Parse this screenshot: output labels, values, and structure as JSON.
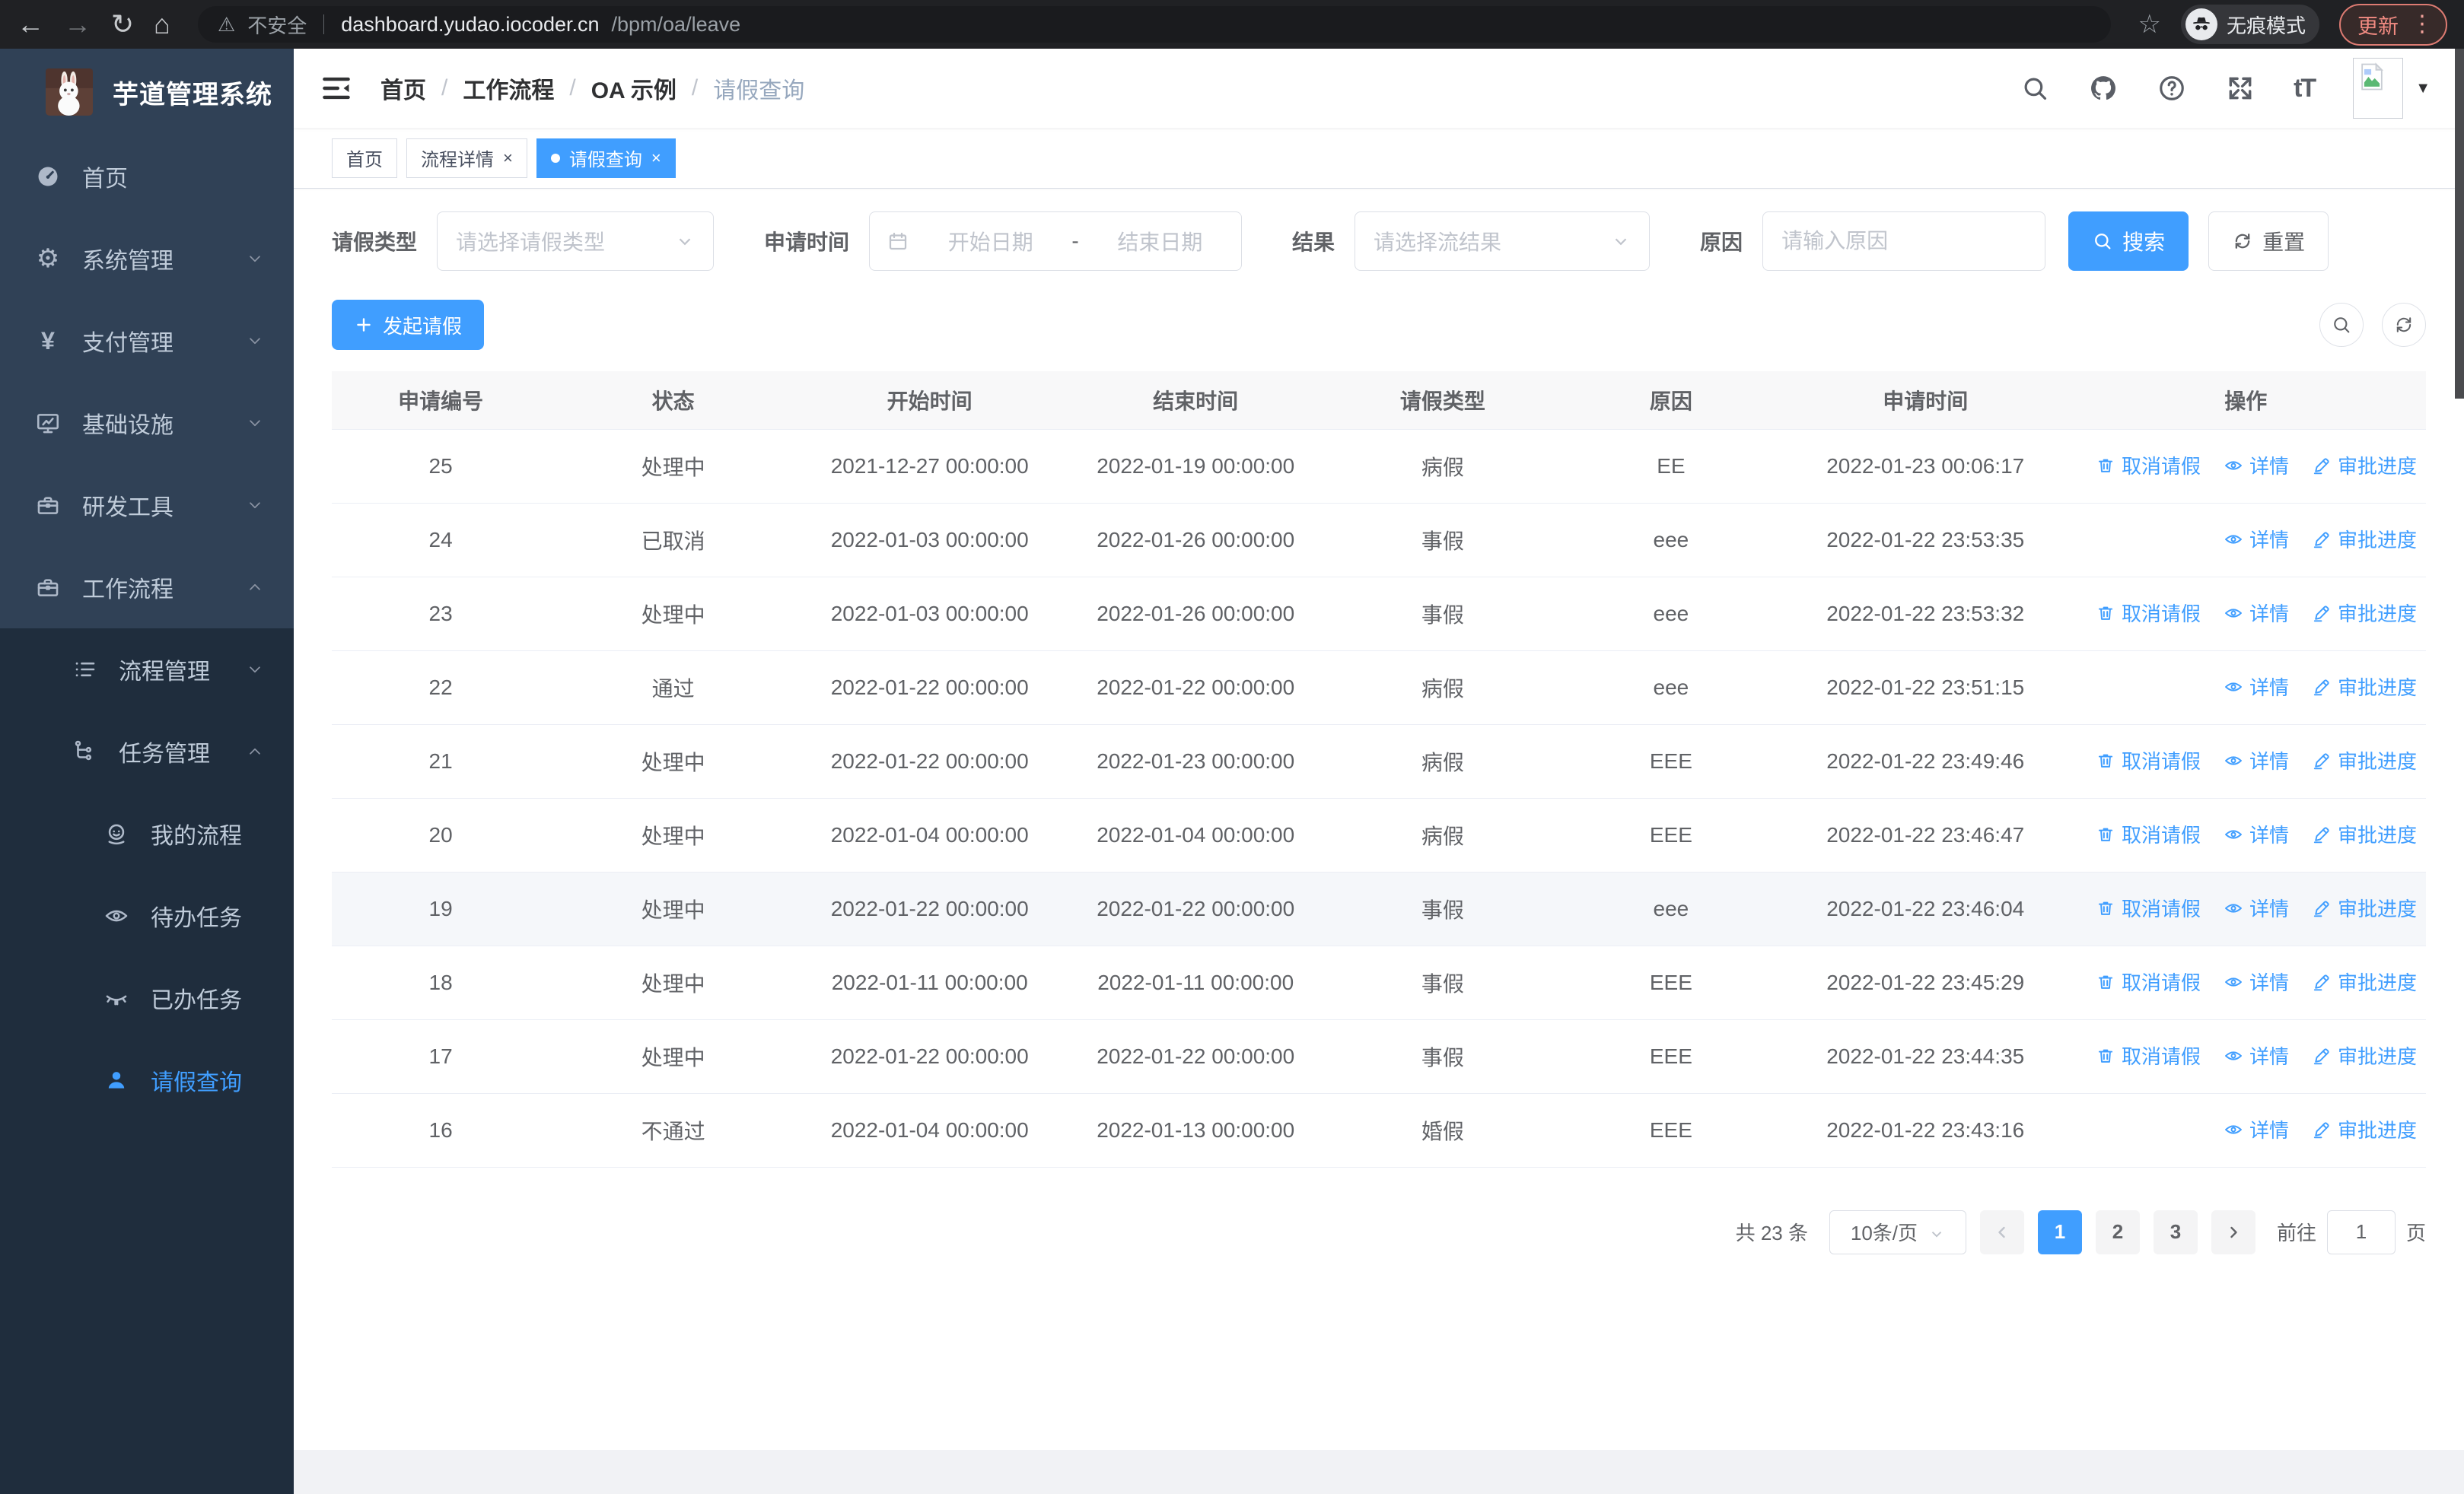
{
  "browser": {
    "security_label": "不安全",
    "url_domain": "dashboard.yudao.iocoder.cn",
    "url_path": "/bpm/oa/leave",
    "incognito_label": "无痕模式",
    "update_label": "更新"
  },
  "sidebar": {
    "title": "芋道管理系统",
    "items": [
      {
        "key": "home",
        "label": "首页",
        "icon": "dashboard",
        "level": 0
      },
      {
        "key": "system",
        "label": "系统管理",
        "icon": "gear",
        "level": 0,
        "arrow": "down"
      },
      {
        "key": "payment",
        "label": "支付管理",
        "icon": "yen",
        "level": 0,
        "arrow": "down"
      },
      {
        "key": "infra",
        "label": "基础设施",
        "icon": "monitor",
        "level": 0,
        "arrow": "down"
      },
      {
        "key": "dev-tools",
        "label": "研发工具",
        "icon": "briefcase",
        "level": 0,
        "arrow": "down"
      },
      {
        "key": "workflow",
        "label": "工作流程",
        "icon": "briefcase",
        "level": 0,
        "arrow": "up"
      },
      {
        "key": "process-mgmt",
        "label": "流程管理",
        "icon": "list",
        "level": 1,
        "sub": true,
        "arrow": "down"
      },
      {
        "key": "task-mgmt",
        "label": "任务管理",
        "icon": "tree",
        "level": 1,
        "sub": true,
        "arrow": "up"
      },
      {
        "key": "my-process",
        "label": "我的流程",
        "icon": "face",
        "level": 2,
        "sub": true
      },
      {
        "key": "todo-tasks",
        "label": "待办任务",
        "icon": "eye",
        "level": 2,
        "sub": true
      },
      {
        "key": "done-tasks",
        "label": "已办任务",
        "icon": "eyeclosed",
        "level": 2,
        "sub": true
      },
      {
        "key": "leave-query",
        "label": "请假查询",
        "icon": "user",
        "level": 2,
        "sub": true,
        "active": true
      }
    ]
  },
  "breadcrumb": [
    {
      "label": "首页"
    },
    {
      "label": "工作流程"
    },
    {
      "label": "OA 示例"
    },
    {
      "label": "请假查询",
      "muted": true
    }
  ],
  "tags": [
    {
      "key": "home",
      "label": "首页"
    },
    {
      "key": "process-detail",
      "label": "流程详情",
      "closable": true
    },
    {
      "key": "leave-query",
      "label": "请假查询",
      "closable": true,
      "active": true
    }
  ],
  "filters": {
    "leave_type": {
      "label": "请假类型",
      "placeholder": "请选择请假类型"
    },
    "apply_time": {
      "label": "申请时间",
      "start_placeholder": "开始日期",
      "separator": "-",
      "end_placeholder": "结束日期"
    },
    "result": {
      "label": "结果",
      "placeholder": "请选择流结果"
    },
    "reason": {
      "label": "原因",
      "placeholder": "请输入原因"
    },
    "search_label": "搜索",
    "reset_label": "重置"
  },
  "toolbar": {
    "create_label": "发起请假"
  },
  "table": {
    "columns": [
      "申请编号",
      "状态",
      "开始时间",
      "结束时间",
      "请假类型",
      "原因",
      "申请时间",
      "操作"
    ],
    "col_widths": [
      10.4,
      11.8,
      12.7,
      12.7,
      10.9,
      10.9,
      13.4,
      17.2
    ],
    "action_labels": {
      "cancel": "取消请假",
      "detail": "详情",
      "progress": "审批进度"
    },
    "rows": [
      {
        "id": "25",
        "status": "处理中",
        "start": "2021-12-27 00:00:00",
        "end": "2022-01-19 00:00:00",
        "type": "病假",
        "reason": "EE",
        "applied": "2022-01-23 00:06:17",
        "can_cancel": true,
        "highlight": false
      },
      {
        "id": "24",
        "status": "已取消",
        "start": "2022-01-03 00:00:00",
        "end": "2022-01-26 00:00:00",
        "type": "事假",
        "reason": "eee",
        "applied": "2022-01-22 23:53:35",
        "can_cancel": false,
        "highlight": false
      },
      {
        "id": "23",
        "status": "处理中",
        "start": "2022-01-03 00:00:00",
        "end": "2022-01-26 00:00:00",
        "type": "事假",
        "reason": "eee",
        "applied": "2022-01-22 23:53:32",
        "can_cancel": true,
        "highlight": false
      },
      {
        "id": "22",
        "status": "通过",
        "start": "2022-01-22 00:00:00",
        "end": "2022-01-22 00:00:00",
        "type": "病假",
        "reason": "eee",
        "applied": "2022-01-22 23:51:15",
        "can_cancel": false,
        "highlight": false
      },
      {
        "id": "21",
        "status": "处理中",
        "start": "2022-01-22 00:00:00",
        "end": "2022-01-23 00:00:00",
        "type": "病假",
        "reason": "EEE",
        "applied": "2022-01-22 23:49:46",
        "can_cancel": true,
        "highlight": false
      },
      {
        "id": "20",
        "status": "处理中",
        "start": "2022-01-04 00:00:00",
        "end": "2022-01-04 00:00:00",
        "type": "病假",
        "reason": "EEE",
        "applied": "2022-01-22 23:46:47",
        "can_cancel": true,
        "highlight": false
      },
      {
        "id": "19",
        "status": "处理中",
        "start": "2022-01-22 00:00:00",
        "end": "2022-01-22 00:00:00",
        "type": "事假",
        "reason": "eee",
        "applied": "2022-01-22 23:46:04",
        "can_cancel": true,
        "highlight": true
      },
      {
        "id": "18",
        "status": "处理中",
        "start": "2022-01-11 00:00:00",
        "end": "2022-01-11 00:00:00",
        "type": "事假",
        "reason": "EEE",
        "applied": "2022-01-22 23:45:29",
        "can_cancel": true,
        "highlight": false
      },
      {
        "id": "17",
        "status": "处理中",
        "start": "2022-01-22 00:00:00",
        "end": "2022-01-22 00:00:00",
        "type": "事假",
        "reason": "EEE",
        "applied": "2022-01-22 23:44:35",
        "can_cancel": true,
        "highlight": false
      },
      {
        "id": "16",
        "status": "不通过",
        "start": "2022-01-04 00:00:00",
        "end": "2022-01-13 00:00:00",
        "type": "婚假",
        "reason": "EEE",
        "applied": "2022-01-22 23:43:16",
        "can_cancel": false,
        "highlight": false
      }
    ]
  },
  "pagination": {
    "total_text": "共 23 条",
    "page_size": "10条/页",
    "pages": [
      "1",
      "2",
      "3"
    ],
    "active_page": "1",
    "goto_label": "前往",
    "goto_value": "1",
    "page_suffix": "页"
  },
  "colors": {
    "accent": "#409eff",
    "sidebar_bg": "#304156",
    "submenu_bg": "#1f2d3d"
  }
}
